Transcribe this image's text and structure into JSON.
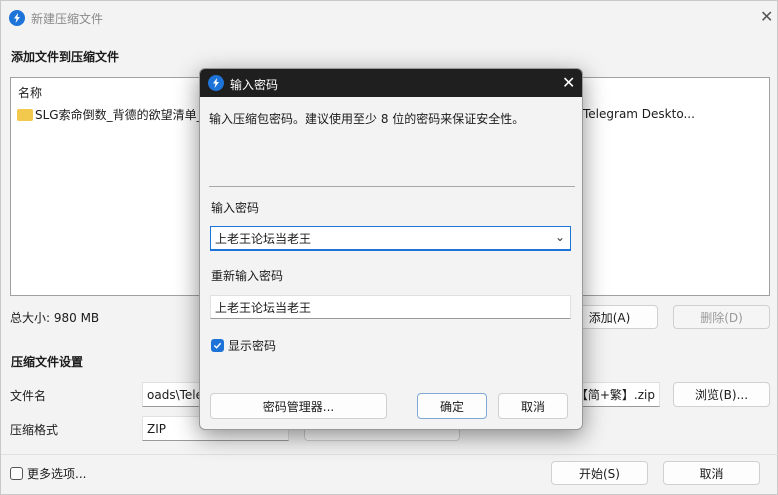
{
  "main": {
    "title": "新建压缩文件",
    "add_section": "添加文件到压缩文件",
    "list_header": "名称",
    "list_items": [
      {
        "name": "SLG索命倒数_背德的欲望清单_"
      },
      {
        "name": "Telegram Deskto..."
      }
    ],
    "total_size": "总大小: 980 MB",
    "add_button": "添加(A)",
    "delete_button": "删除(D)",
    "settings_section": "压缩文件设置",
    "filename_label": "文件名",
    "filename_value": "oads\\Tele",
    "filename_suffix": "【简+繁】.zip",
    "browse_button": "浏览(B)...",
    "format_label": "压缩格式",
    "format_value": "ZIP",
    "more_options": "更多选项...",
    "start_button": "开始(S)",
    "cancel_button": "取消"
  },
  "dialog": {
    "title": "输入密码",
    "description": "输入压缩包密码。建议使用至少 8 位的密码来保证安全性。",
    "password_label": "输入密码",
    "password_value": "上老王论坛当老王",
    "confirm_label": "重新输入密码",
    "confirm_value": "上老王论坛当老王",
    "show_password": "显示密码",
    "show_password_checked": true,
    "manager_button": "密码管理器...",
    "ok_button": "确定",
    "cancel_button": "取消"
  },
  "colors": {
    "accent": "#1e73d8",
    "dialog_titlebar": "#1f1f1f"
  }
}
